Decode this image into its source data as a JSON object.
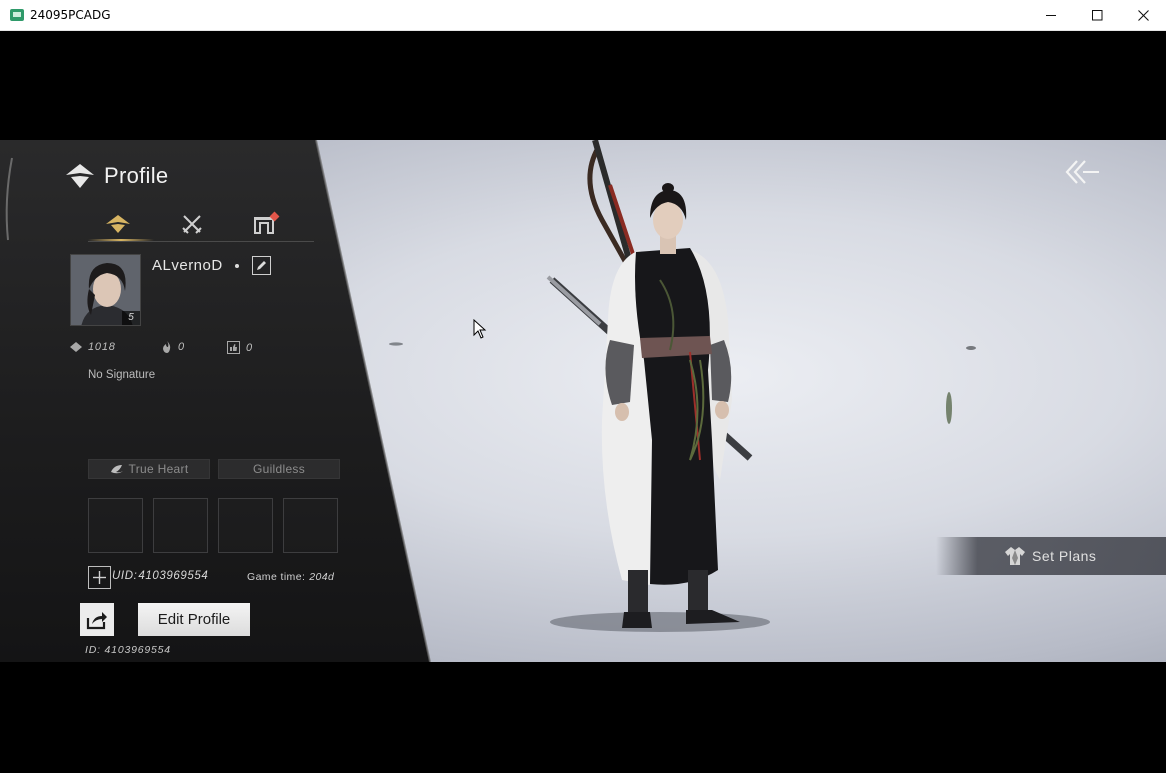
{
  "window": {
    "title": "24095PCADG",
    "controls": [
      "minimize",
      "maximize",
      "close"
    ]
  },
  "profile": {
    "header_title": "Profile",
    "tabs": [
      {
        "name": "profile",
        "icon": "profile-emblem-icon",
        "active": true
      },
      {
        "name": "combat",
        "icon": "crossed-swords-icon",
        "active": false
      },
      {
        "name": "sect",
        "icon": "gate-icon",
        "active": false,
        "notification": true
      }
    ],
    "avatar_level": "5",
    "username": "ALvernoD",
    "stats": [
      {
        "icon": "emblem-icon",
        "value": "1018"
      },
      {
        "icon": "flame-icon",
        "value": "0"
      },
      {
        "icon": "thumbs-up-icon",
        "value": "0"
      }
    ],
    "signature": "No Signature",
    "tags": [
      {
        "label": "True Heart",
        "icon": "heart-icon"
      },
      {
        "label": "Guildless"
      }
    ],
    "uid_label": "UID:",
    "uid_value": "4103969554",
    "game_time_label": "Game time:",
    "game_time_value": "204d",
    "edit_profile_label": "Edit Profile",
    "id_footer": "ID: 4103969554"
  },
  "actions": {
    "set_plans_label": "Set Plans"
  },
  "colors": {
    "accent_gold": "#d8b563",
    "notification_red": "#e2564a",
    "panel_bg": "#1d1d1e"
  }
}
